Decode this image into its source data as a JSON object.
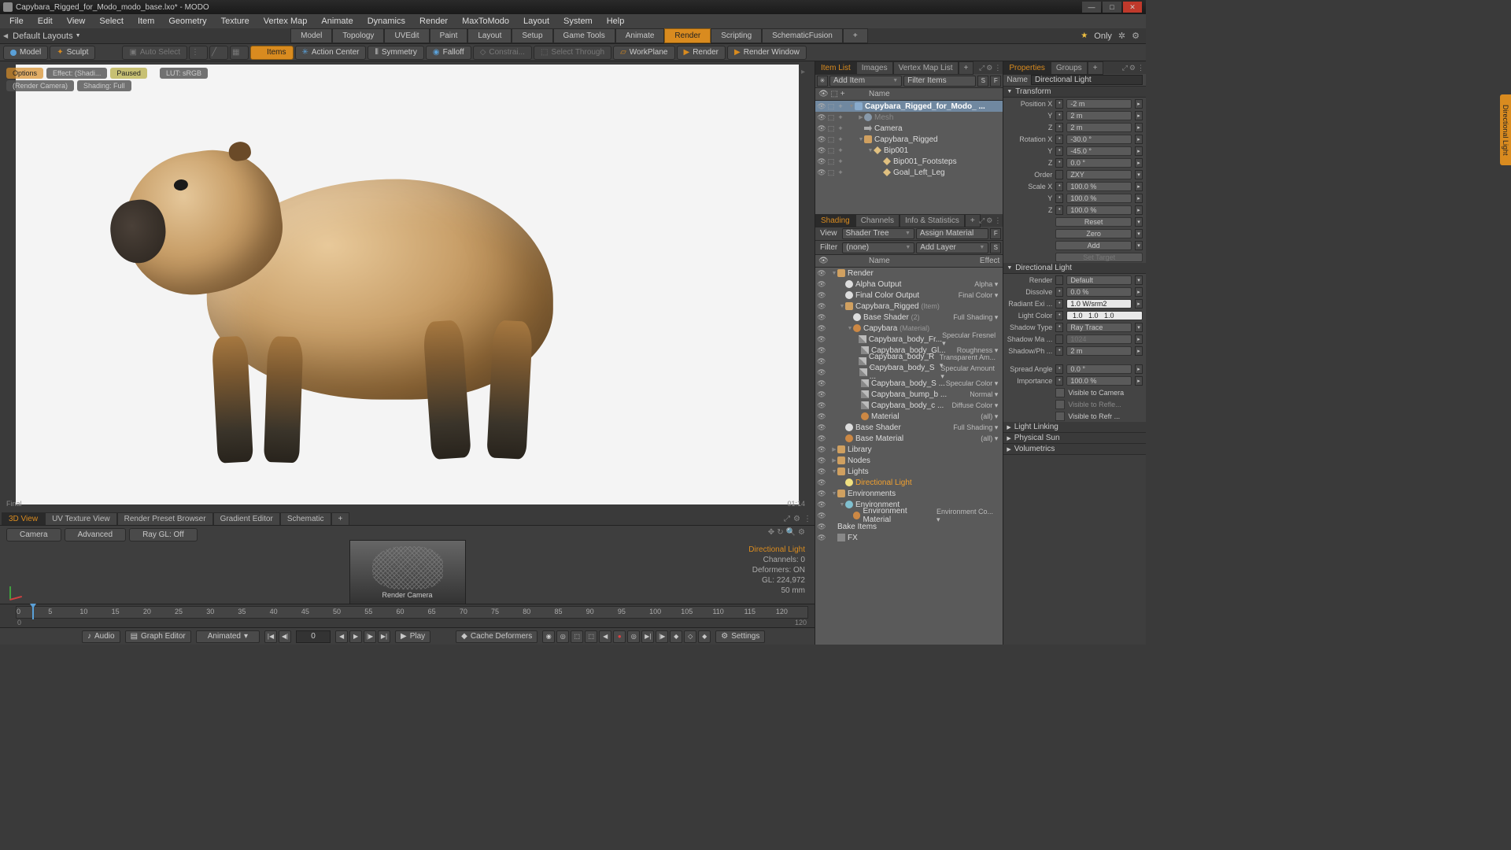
{
  "title": "Capybara_Rigged_for_Modo_modo_base.lxo* - MODO",
  "menu": [
    "File",
    "Edit",
    "View",
    "Select",
    "Item",
    "Geometry",
    "Texture",
    "Vertex Map",
    "Animate",
    "Dynamics",
    "Render",
    "MaxToModo",
    "Layout",
    "System",
    "Help"
  ],
  "layout": {
    "default": "Default Layouts",
    "tabs": [
      "Model",
      "Topology",
      "UVEdit",
      "Paint",
      "Layout",
      "Setup",
      "Game Tools",
      "Animate",
      "Render",
      "Scripting",
      "SchematicFusion"
    ],
    "active": "Render",
    "only": "Only"
  },
  "toolbar": {
    "model": "Model",
    "sculpt": "Sculpt",
    "autoselect": "Auto Select",
    "items": "Items",
    "actioncenter": "Action Center",
    "symmetry": "Symmetry",
    "falloff": "Falloff",
    "constrain": "Constrai...",
    "selectthrough": "Select Through",
    "workplane": "WorkPlane",
    "render": "Render",
    "renderwindow": "Render Window"
  },
  "render_overlay": {
    "options": "Options",
    "effect": "Effect: (Shadi...",
    "paused": "Paused",
    "lut": "LUT: sRGB",
    "camera": "(Render Camera)",
    "shading": "Shading: Full",
    "time": "01:14",
    "status": "Final"
  },
  "bottom_tabs": [
    "3D View",
    "UV Texture View",
    "Render Preset Browser",
    "Gradient Editor",
    "Schematic"
  ],
  "preview_buttons": [
    "Camera",
    "Advanced",
    "Ray GL: Off"
  ],
  "preview_info": {
    "name": "Directional Light",
    "channels": "Channels: 0",
    "deformers": "Deformers: ON",
    "gl": "GL: 224,972",
    "lens": "50 mm"
  },
  "preview_label": "Render Camera",
  "timeline": {
    "marks": [
      "0",
      "5",
      "10",
      "15",
      "20",
      "25",
      "30",
      "35",
      "40",
      "45",
      "50",
      "55",
      "60",
      "65",
      "70",
      "75",
      "80",
      "85",
      "90",
      "95",
      "100",
      "105",
      "110",
      "115",
      "120"
    ],
    "start": "0",
    "end": "120"
  },
  "playbar": {
    "audio": "Audio",
    "graph": "Graph Editor",
    "animated": "Animated",
    "frame": "0",
    "play": "Play",
    "cache": "Cache Deformers",
    "settings": "Settings"
  },
  "item_tabs": [
    "Item List",
    "Images",
    "Vertex Map List"
  ],
  "item_toolbar": {
    "add": "Add Item",
    "filter": "Filter Items"
  },
  "item_header": {
    "name": "Name"
  },
  "items": [
    {
      "ind": 0,
      "ico": "scene",
      "name": "Capybara_Rigged_for_Modo_ ...",
      "tog": "▼",
      "bold": true,
      "sel": true
    },
    {
      "ind": 1,
      "ico": "mesh",
      "name": "Mesh",
      "tog": "▶",
      "dim": true
    },
    {
      "ind": 1,
      "ico": "cam",
      "name": "Camera"
    },
    {
      "ind": 1,
      "ico": "grp",
      "name": "Capybara_Rigged",
      "tog": "▼"
    },
    {
      "ind": 2,
      "ico": "bone",
      "name": "Bip001",
      "tog": "▼"
    },
    {
      "ind": 3,
      "ico": "bone",
      "name": "Bip001_Footsteps"
    },
    {
      "ind": 3,
      "ico": "bone",
      "name": "Goal_Left_Leg"
    }
  ],
  "shade_tabs": [
    "Shading",
    "Channels",
    "Info & Statistics"
  ],
  "shade_toolbar": {
    "view": "View",
    "tree": "Shader Tree",
    "assign": "Assign Material",
    "filter": "Filter",
    "none": "(none)",
    "addlayer": "Add Layer"
  },
  "shade_header": {
    "name": "Name",
    "effect": "Effect"
  },
  "shading": [
    {
      "ind": 0,
      "ico": "grp",
      "name": "Render",
      "tog": "▼"
    },
    {
      "ind": 1,
      "ico": "shader",
      "name": "Alpha Output",
      "eff": "Alpha"
    },
    {
      "ind": 1,
      "ico": "shader",
      "name": "Final Color Output",
      "eff": "Final Color"
    },
    {
      "ind": 1,
      "ico": "grp",
      "name": "Capybara_Rigged",
      "suffix": "(Item)",
      "tog": "▼"
    },
    {
      "ind": 2,
      "ico": "shader",
      "name": "Base Shader",
      "suffix": "(2)",
      "eff": "Full Shading"
    },
    {
      "ind": 2,
      "ico": "mat",
      "name": "Capybara",
      "suffix": "(Material)",
      "tog": "▼"
    },
    {
      "ind": 3,
      "ico": "tex",
      "name": "Capybara_body_Fr...",
      "eff": "Specular Fresnel"
    },
    {
      "ind": 3,
      "ico": "tex",
      "name": "Capybara_body_Gl...",
      "eff": "Roughness"
    },
    {
      "ind": 3,
      "ico": "tex",
      "name": "Capybara_body_R ...",
      "eff": "Transparent Am..."
    },
    {
      "ind": 3,
      "ico": "tex",
      "name": "Capybara_body_S ...",
      "eff": "Specular Amount"
    },
    {
      "ind": 3,
      "ico": "tex",
      "name": "Capybara_body_S ...",
      "eff": "Specular Color"
    },
    {
      "ind": 3,
      "ico": "tex",
      "name": "Capybara_bump_b ...",
      "eff": "Normal"
    },
    {
      "ind": 3,
      "ico": "tex",
      "name": "Capybara_body_c ...",
      "eff": "Diffuse Color"
    },
    {
      "ind": 3,
      "ico": "mat",
      "name": "Material",
      "eff": "(all)"
    },
    {
      "ind": 1,
      "ico": "shader",
      "name": "Base Shader",
      "eff": "Full Shading"
    },
    {
      "ind": 1,
      "ico": "mat",
      "name": "Base Material",
      "eff": "(all)"
    },
    {
      "ind": 0,
      "ico": "grp",
      "name": "Library",
      "tog": "▶"
    },
    {
      "ind": 0,
      "ico": "grp",
      "name": "Nodes",
      "tog": "▶"
    },
    {
      "ind": 0,
      "ico": "grp",
      "name": "Lights",
      "tog": "▼"
    },
    {
      "ind": 1,
      "ico": "light",
      "name": "Directional Light",
      "selor": true
    },
    {
      "ind": 0,
      "ico": "grp",
      "name": "Environments",
      "tog": "▼"
    },
    {
      "ind": 1,
      "ico": "env",
      "name": "Environment",
      "tog": "▼"
    },
    {
      "ind": 2,
      "ico": "mat",
      "name": "Environment Material",
      "eff": "Environment Co..."
    },
    {
      "ind": 0,
      "name": "Bake Items"
    },
    {
      "ind": 0,
      "ico": "fx",
      "name": "FX"
    }
  ],
  "prop_tabs": [
    "Properties",
    "Groups"
  ],
  "prop_name": {
    "label": "Name",
    "value": "Directional Light"
  },
  "transform": {
    "header": "Transform",
    "position": {
      "label": "Position X",
      "x": "-2 m",
      "y": "2 m",
      "z": "2 m"
    },
    "rotation": {
      "label": "Rotation X",
      "x": "-30.0 °",
      "y": "-45.0 °",
      "z": "0.0 °"
    },
    "order": {
      "label": "Order",
      "value": "ZXY"
    },
    "scale": {
      "label": "Scale X",
      "x": "100.0 %",
      "y": "100.0 %",
      "z": "100.0 %"
    },
    "reset": "Reset",
    "zero": "Zero",
    "add": "Add",
    "settarget": "Set Target"
  },
  "light": {
    "header": "Directional Light",
    "render": {
      "label": "Render",
      "value": "Default"
    },
    "dissolve": {
      "label": "Dissolve",
      "value": "0.0 %"
    },
    "radiant": {
      "label": "Radiant Exi ...",
      "value": "1.0 W/srm2"
    },
    "color": {
      "label": "Light Color",
      "r": "1.0",
      "g": "1.0",
      "b": "1.0"
    },
    "shadowtype": {
      "label": "Shadow Type",
      "value": "Ray Trace"
    },
    "shadowmap": {
      "label": "Shadow Ma ...",
      "value": "1024"
    },
    "shadowph": {
      "label": "Shadow/Ph ...",
      "value": "2 m"
    },
    "spread": {
      "label": "Spread Angle",
      "value": "0.0 °"
    },
    "importance": {
      "label": "Importance",
      "value": "100.0 %"
    },
    "viscam": "Visible to Camera",
    "visrefl": "Visible to Refle...",
    "visrefr": "Visible to Refr ..."
  },
  "collapsed_sections": [
    "Light Linking",
    "Physical Sun",
    "Volumetrics"
  ],
  "vert_tab": "Directional Light"
}
